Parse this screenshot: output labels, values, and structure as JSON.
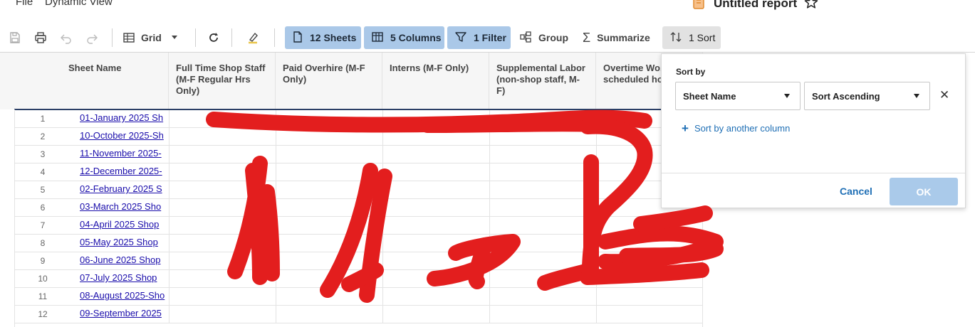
{
  "menu": {
    "file": "File",
    "view": "Dynamic View"
  },
  "report": {
    "title": "Untitled report"
  },
  "toolbar": {
    "grid_label": "Grid",
    "sheets_label": "12 Sheets",
    "columns_label": "5 Columns",
    "filter_label": "1 Filter",
    "group_label": "Group",
    "summarize_label": "Summarize",
    "sort_label": "1 Sort"
  },
  "grid": {
    "columns": [
      "Sheet Name",
      "Full Time Shop Staff (M-F Regular Hrs Only)",
      "Paid Overhire (M-F Only)",
      "Interns (M-F Only)",
      "Supplemental Labor (non-shop staff, M-F)",
      "Overtime Wo... scheduled ho..."
    ],
    "rows": [
      {
        "num": "1",
        "sheet": "01-January 2025 Sh"
      },
      {
        "num": "2",
        "sheet": "10-October 2025-Sh"
      },
      {
        "num": "3",
        "sheet": "11-November 2025-"
      },
      {
        "num": "4",
        "sheet": "12-December 2025-"
      },
      {
        "num": "5",
        "sheet": "02-February 2025 S"
      },
      {
        "num": "6",
        "sheet": "03-March 2025 Sho"
      },
      {
        "num": "7",
        "sheet": "04-April 2025 Shop"
      },
      {
        "num": "8",
        "sheet": "05-May 2025 Shop"
      },
      {
        "num": "9",
        "sheet": "06-June 2025 Shop"
      },
      {
        "num": "10",
        "sheet": "07-July 2025 Shop"
      },
      {
        "num": "11",
        "sheet": "08-August 2025-Sho"
      },
      {
        "num": "12",
        "sheet": "09-September 2025"
      }
    ]
  },
  "sort_panel": {
    "label": "Sort by",
    "field": "Sheet Name",
    "order": "Sort Ascending",
    "add_label": "Sort by another column",
    "cancel": "Cancel",
    "ok": "OK"
  },
  "colors": {
    "chip_active": "#aac8e8",
    "link": "#1a0dab",
    "accent_blue": "#1f6fb5",
    "scribble": "#e31e1e"
  }
}
